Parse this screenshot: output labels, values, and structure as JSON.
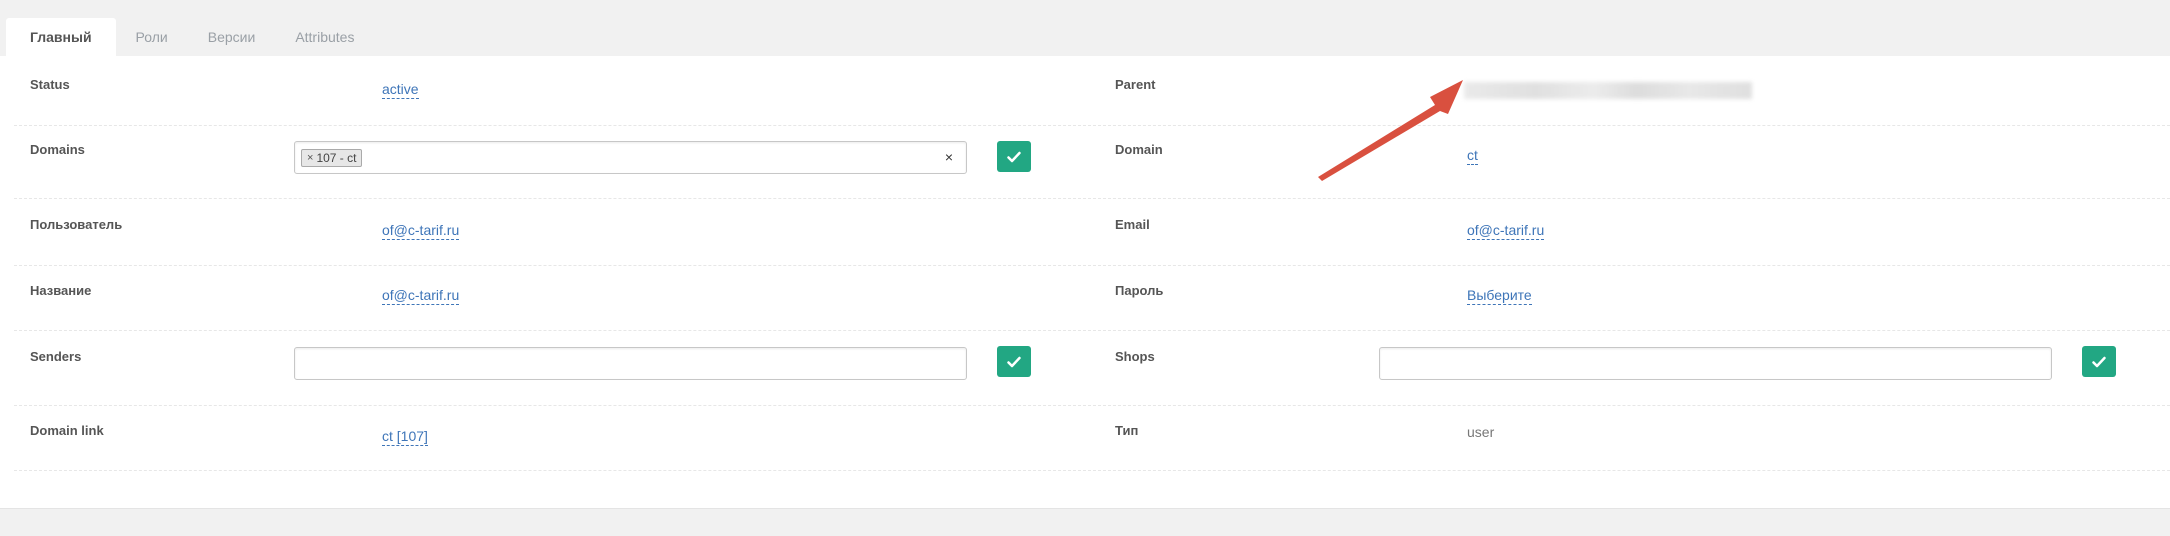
{
  "tabs": [
    "Главный",
    "Роли",
    "Версии",
    "Attributes"
  ],
  "fields": {
    "status": {
      "label": "Status",
      "value": "active"
    },
    "parent": {
      "label": "Parent"
    },
    "domains": {
      "label": "Domains",
      "tag": "107 - ct",
      "tag_remove": "×",
      "clear": "×"
    },
    "domain": {
      "label": "Domain",
      "value": "ct"
    },
    "user": {
      "label": "Пользователь",
      "value": "of@c-tarif.ru"
    },
    "email": {
      "label": "Email",
      "value": "of@c-tarif.ru"
    },
    "name": {
      "label": "Название",
      "value": "of@c-tarif.ru"
    },
    "password": {
      "label": "Пароль",
      "value": "Выберите"
    },
    "senders": {
      "label": "Senders",
      "value": ""
    },
    "shops": {
      "label": "Shops",
      "value": ""
    },
    "domain_link": {
      "label": "Domain link",
      "value": "ct [107]"
    },
    "type": {
      "label": "Тип",
      "value": "user"
    }
  },
  "colors": {
    "accent": "#22a783",
    "link": "#3e75b8",
    "annotation_arrow": "#d9503f"
  },
  "icons": {
    "confirm": "check-icon",
    "annotation": "red-arrow"
  }
}
